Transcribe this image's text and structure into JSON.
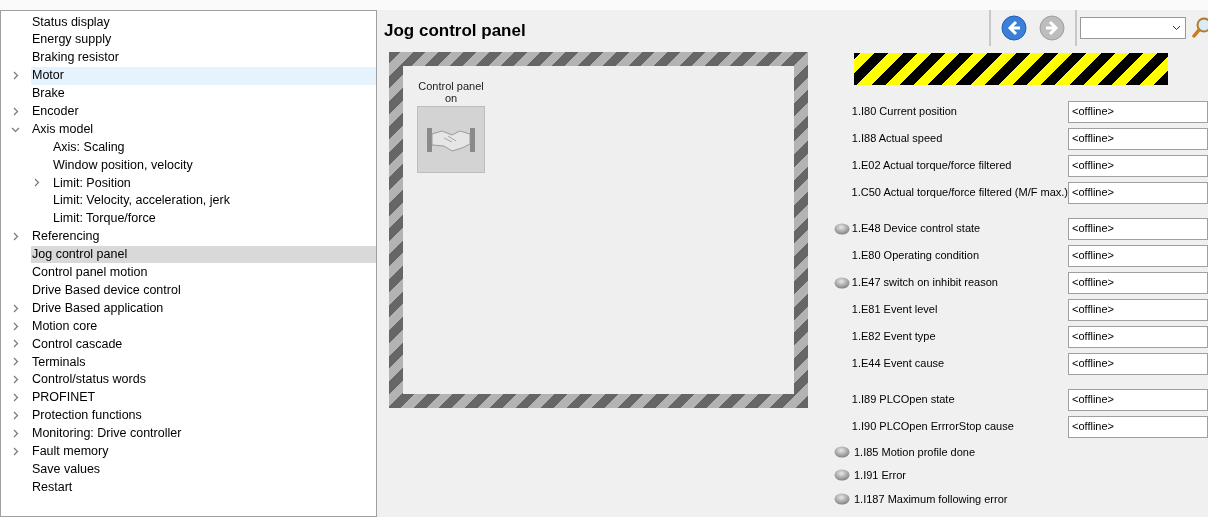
{
  "sidebar": {
    "items": [
      {
        "label": "Status display",
        "selected": false,
        "hovered": false
      },
      {
        "label": "Energy supply",
        "selected": false,
        "hovered": false
      },
      {
        "label": "Braking resistor",
        "selected": false,
        "hovered": false
      },
      {
        "label": "Motor",
        "selected": false,
        "hovered": true,
        "expanded": false
      },
      {
        "label": "Brake",
        "selected": false,
        "hovered": false
      },
      {
        "label": "Encoder",
        "selected": false,
        "hovered": false,
        "expanded": false
      },
      {
        "label": "Axis model",
        "selected": false,
        "hovered": false,
        "expanded": true,
        "children": [
          {
            "label": "Axis: Scaling",
            "selected": false,
            "hovered": false
          },
          {
            "label": "Window position, velocity",
            "selected": false,
            "hovered": false
          },
          {
            "label": "Limit: Position",
            "selected": false,
            "hovered": false,
            "expanded": false
          },
          {
            "label": "Limit: Velocity, acceleration, jerk",
            "selected": false,
            "hovered": false
          },
          {
            "label": "Limit: Torque/force",
            "selected": false,
            "hovered": false
          }
        ]
      },
      {
        "label": "Referencing",
        "selected": false,
        "hovered": false,
        "expanded": false
      },
      {
        "label": "Jog control panel",
        "selected": true
      },
      {
        "label": "Control panel motion",
        "selected": false,
        "hovered": false
      },
      {
        "label": "Drive Based device control",
        "selected": false,
        "hovered": false
      },
      {
        "label": "Drive Based application",
        "selected": false,
        "hovered": false,
        "expanded": false
      },
      {
        "label": "Motion core",
        "selected": false,
        "hovered": false,
        "expanded": false
      },
      {
        "label": "Control cascade",
        "selected": false,
        "hovered": false,
        "expanded": false
      },
      {
        "label": "Terminals",
        "selected": false,
        "hovered": false,
        "expanded": false
      },
      {
        "label": "Control/status words",
        "selected": false,
        "hovered": false,
        "expanded": false
      },
      {
        "label": "PROFINET",
        "selected": false,
        "hovered": false,
        "expanded": false
      },
      {
        "label": "Protection functions",
        "selected": false,
        "hovered": false,
        "expanded": false
      },
      {
        "label": "Monitoring: Drive controller",
        "selected": false,
        "hovered": false,
        "expanded": false
      },
      {
        "label": "Fault memory",
        "selected": false,
        "hovered": false,
        "expanded": false
      },
      {
        "label": "Save values",
        "selected": false,
        "hovered": false
      },
      {
        "label": "Restart",
        "selected": false,
        "hovered": false
      }
    ]
  },
  "page": {
    "title": "Jog control panel"
  },
  "toolbar": {
    "back_disabled": false,
    "forward_disabled": true
  },
  "control_panel_button": {
    "label": "Control panel on"
  },
  "groups": [
    [
      {
        "label": "1.I80 Current position",
        "led": false,
        "value": "<offline>"
      },
      {
        "label": "1.I88 Actual speed",
        "led": false,
        "value": "<offline>"
      },
      {
        "label": "1.E02 Actual torque/force filtered",
        "led": false,
        "value": "<offline>"
      },
      {
        "label": "1.C50 Actual torque/force filtered (M/F max.)",
        "led": false,
        "value": "<offline>"
      }
    ],
    [
      {
        "label": "1.E48 Device control state",
        "led": true,
        "value": "<offline>"
      },
      {
        "label": "1.E80 Operating condition",
        "led": false,
        "value": "<offline>"
      },
      {
        "label": "1.E47 switch on inhibit reason",
        "led": true,
        "value": "<offline>"
      },
      {
        "label": "1.E81 Event level",
        "led": false,
        "value": "<offline>"
      },
      {
        "label": "1.E82 Event type",
        "led": false,
        "value": "<offline>"
      },
      {
        "label": "1.E44 Event cause",
        "led": false,
        "value": "<offline>"
      }
    ],
    [
      {
        "label": "1.I89 PLCOpen state",
        "led": false,
        "value": "<offline>"
      },
      {
        "label": "1.I90 PLCOpen ErrrorStop cause",
        "led": false,
        "value": "<offline>"
      },
      {
        "label": "1.I85 Motion profile done",
        "led": true
      },
      {
        "label": "1.I91 Error",
        "led": true
      },
      {
        "label": "1.I187 Maximum following error",
        "led": true
      }
    ]
  ]
}
